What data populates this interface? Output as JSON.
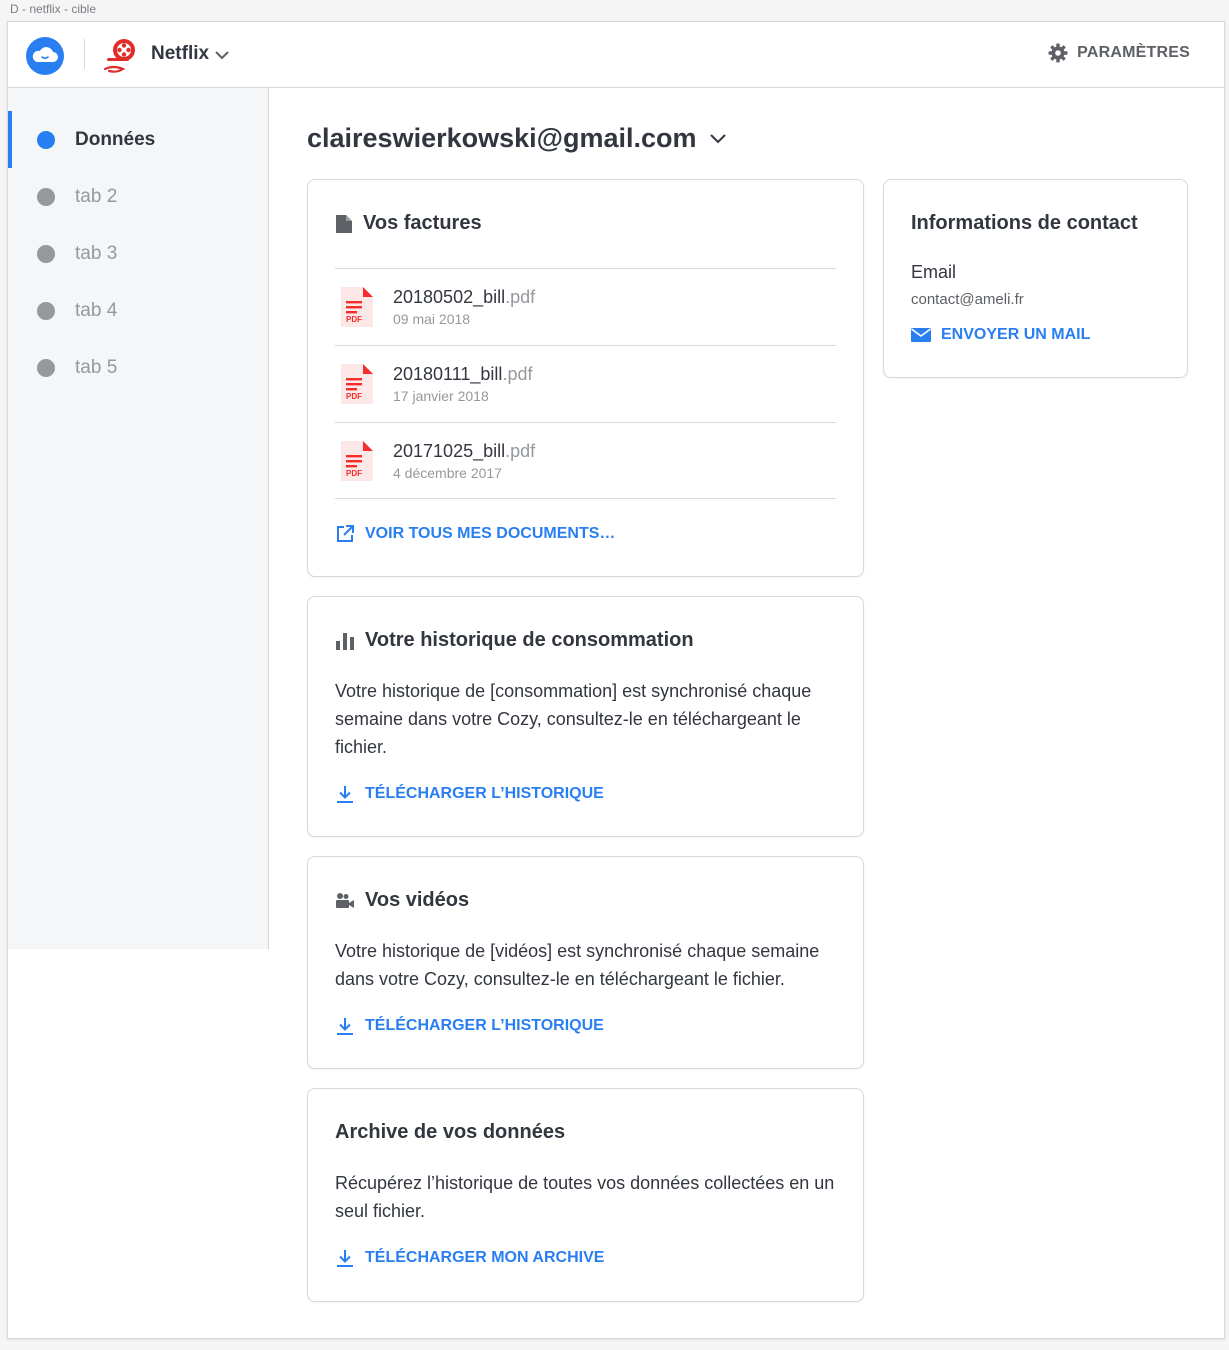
{
  "window_title": "D - netflix - cible",
  "topbar": {
    "app_name": "Netflix",
    "settings_label": "PARAMÈTRES"
  },
  "sidebar": {
    "items": [
      {
        "label": "Données",
        "active": true
      },
      {
        "label": "tab 2",
        "active": false
      },
      {
        "label": "tab 3",
        "active": false
      },
      {
        "label": "tab 4",
        "active": false
      },
      {
        "label": "tab 5",
        "active": false
      }
    ]
  },
  "account": {
    "email": "claireswierkowski@gmail.com"
  },
  "bills": {
    "title": "Vos factures",
    "items": [
      {
        "name": "20180502_bill",
        "ext": ".pdf",
        "date": "09 mai 2018"
      },
      {
        "name": "20180111_bill",
        "ext": ".pdf",
        "date": "17 janvier 2018"
      },
      {
        "name": "20171025_bill",
        "ext": ".pdf",
        "date": "4 décembre 2017"
      }
    ],
    "see_all_label": "VOIR TOUS MES DOCUMENTS…",
    "pdf_badge": "PDF"
  },
  "consumption": {
    "title": "Votre historique de consommation",
    "text": "Votre historique de [consommation] est synchronisé chaque semaine dans votre Cozy, consultez-le en téléchargeant le fichier.",
    "action_label": "TÉLÉCHARGER L’HISTORIQUE"
  },
  "videos": {
    "title": "Vos vidéos",
    "text": "Votre historique de [vidéos] est synchronisé chaque semaine dans votre Cozy, consultez-le en téléchargeant le fichier.",
    "action_label": "TÉLÉCHARGER L’HISTORIQUE"
  },
  "archive": {
    "title": "Archive de vos données",
    "text": "Récupérez l’historique de toutes vos données collectées en un seul fichier.",
    "action_label": "TÉLÉCHARGER MON ARCHIVE"
  },
  "contact": {
    "title": "Informations de contact",
    "email_label": "Email",
    "email_value": "contact@ameli.fr",
    "action_label": "ENVOYER UN MAIL"
  },
  "colors": {
    "accent": "#297ef2",
    "text": "#32363f",
    "muted": "#95999d",
    "pdf_red": "#f52d2d"
  }
}
